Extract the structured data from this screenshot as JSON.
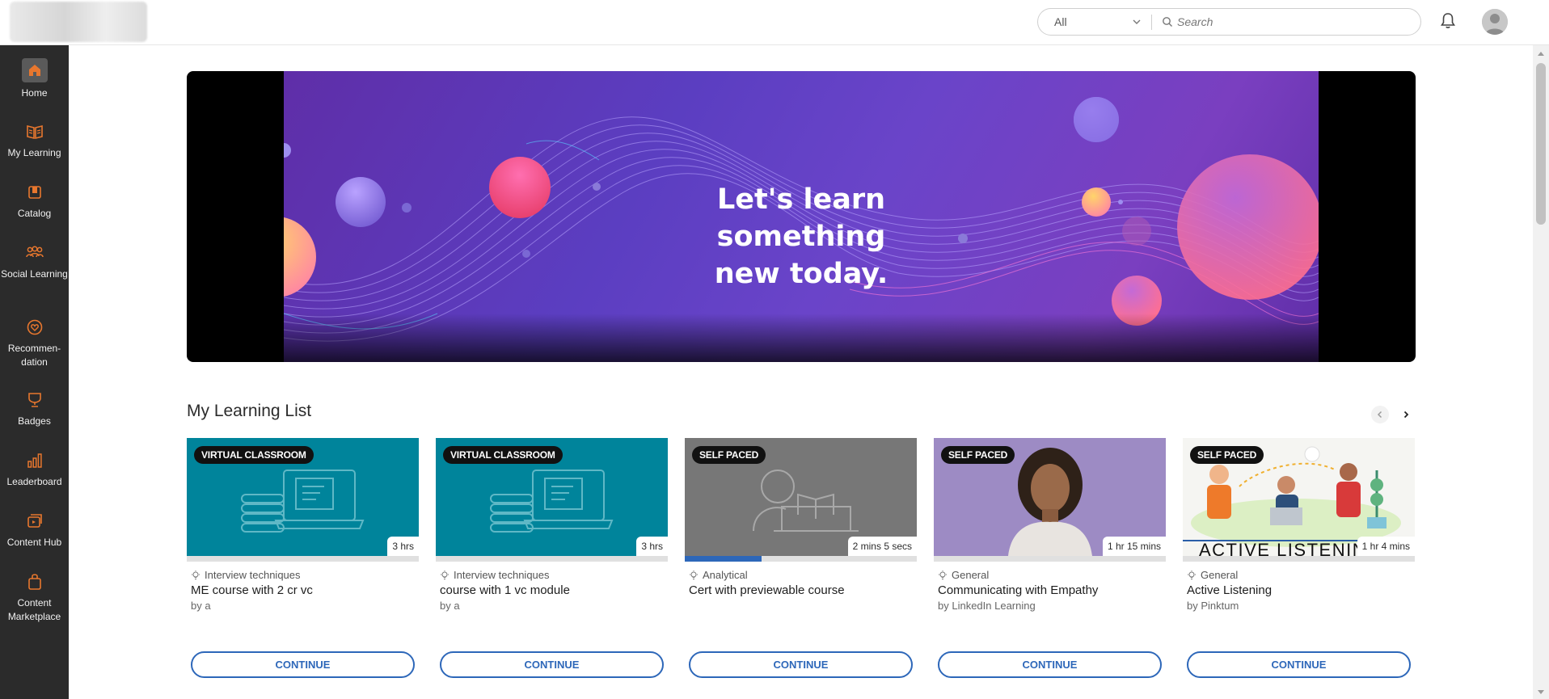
{
  "header": {
    "search_scope": "All",
    "search_placeholder": "Search"
  },
  "sidebar": {
    "items": [
      {
        "label": "Home",
        "icon": "home-icon",
        "active": true
      },
      {
        "label": "My Learning",
        "icon": "book-icon"
      },
      {
        "label": "Catalog",
        "icon": "catalog-icon"
      },
      {
        "label": "Social Learning",
        "icon": "people-icon"
      },
      {
        "label": "Recommen- dation",
        "icon": "heart-badge-icon"
      },
      {
        "label": "Badges",
        "icon": "badge-icon"
      },
      {
        "label": "Leaderboard",
        "icon": "bar-chart-icon"
      },
      {
        "label": "Content Hub",
        "icon": "content-hub-icon"
      },
      {
        "label": "Content Marketplace",
        "icon": "bag-icon"
      }
    ]
  },
  "banner": {
    "line1": "Let's learn something",
    "line2": "new today."
  },
  "learning_list": {
    "title": "My Learning List",
    "cards": [
      {
        "badge": "VIRTUAL CLASSROOM",
        "duration": "3 hrs",
        "skill": "Interview techniques",
        "title": "ME course with 2 cr vc",
        "author": "by a",
        "cta": "CONTINUE",
        "progress": 0
      },
      {
        "badge": "VIRTUAL CLASSROOM",
        "duration": "3 hrs",
        "skill": "Interview techniques",
        "title": "course with 1 vc module",
        "author": "by a",
        "cta": "CONTINUE",
        "progress": 0
      },
      {
        "badge": "SELF PACED",
        "duration": "2 mins 5 secs",
        "skill": "Analytical",
        "title": "Cert with previewable course",
        "author": "",
        "cta": "CONTINUE",
        "progress": 0.33
      },
      {
        "badge": "SELF PACED",
        "duration": "1 hr 15 mins",
        "skill": "General",
        "title": "Communicating with Empathy",
        "author": "by LinkedIn Learning",
        "cta": "CONTINUE",
        "progress": 0
      },
      {
        "badge": "SELF PACED",
        "duration": "1 hr 4 mins",
        "skill": "General",
        "title": "Active Listening",
        "author": "by Pinktum",
        "cta": "CONTINUE",
        "progress": 0,
        "thumb_text": "ACTIVE LISTENING"
      }
    ]
  },
  "colors": {
    "accent_orange": "#e8772e",
    "sidebar_bg": "#2b2b2b",
    "button_blue": "#2d67b9",
    "vc_thumb": "#00849b",
    "self_paced_thumb": "#777777"
  }
}
